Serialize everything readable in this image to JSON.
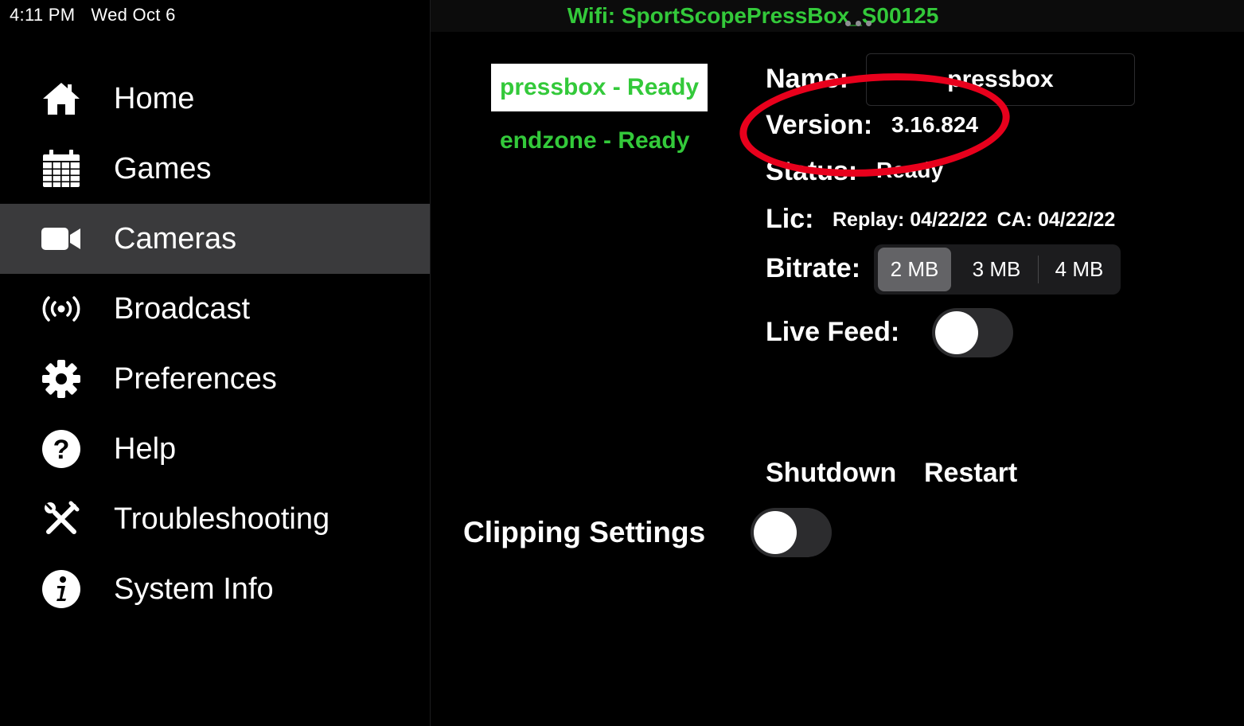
{
  "status_bar": {
    "time": "4:11 PM",
    "date": "Wed Oct 6"
  },
  "sidebar": {
    "active_index": 2,
    "items": [
      {
        "label": "Home",
        "icon": "home-icon"
      },
      {
        "label": "Games",
        "icon": "calendar-icon"
      },
      {
        "label": "Cameras",
        "icon": "video-camera-icon"
      },
      {
        "label": "Broadcast",
        "icon": "broadcast-icon"
      },
      {
        "label": "Preferences",
        "icon": "gear-icon"
      },
      {
        "label": "Help",
        "icon": "question-icon"
      },
      {
        "label": "Troubleshooting",
        "icon": "tools-icon"
      },
      {
        "label": "System Info",
        "icon": "info-icon"
      }
    ]
  },
  "wifi": {
    "text": "Wifi: SportScopePressBox_S00125"
  },
  "cameras": [
    {
      "label": "pressbox - Ready",
      "selected": true
    },
    {
      "label": "endzone - Ready",
      "selected": false
    }
  ],
  "details": {
    "name_label": "Name:",
    "name_value": "pressbox",
    "version_label": "Version:",
    "version_value": "3.16.824",
    "status_label": "Status:",
    "status_value": "Ready",
    "lic_label": "Lic:",
    "lic_replay": "Replay: 04/22/22",
    "lic_ca": "CA: 04/22/22",
    "bitrate_label": "Bitrate:",
    "bitrate_options": [
      "2 MB",
      "3 MB",
      "4 MB"
    ],
    "bitrate_selected": "2 MB",
    "live_feed_label": "Live Feed:",
    "live_feed_on": false,
    "shutdown_label": "Shutdown",
    "restart_label": "Restart"
  },
  "clipping": {
    "label": "Clipping Settings",
    "on": false
  },
  "colors": {
    "accent_green": "#33c93a",
    "annotation_red": "#e8001c",
    "selected_row": "#3a3a3c"
  }
}
